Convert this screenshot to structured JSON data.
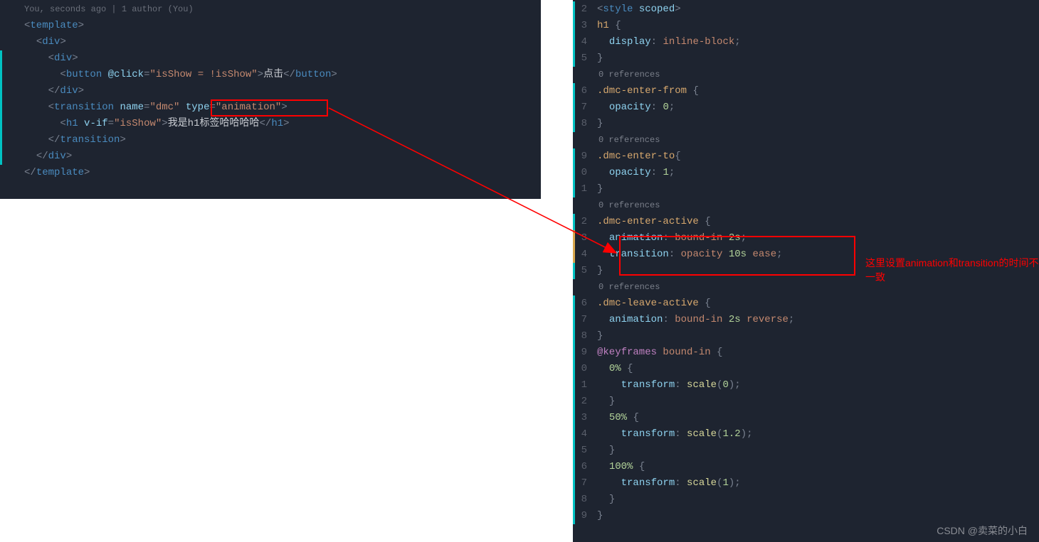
{
  "left": {
    "blame": "You, seconds ago | 1 author (You)",
    "lines": [
      {
        "h": "<span class='punct'>&lt;</span><span class='tag'>template</span><span class='punct'>&gt;</span>"
      },
      {
        "h": "  <span class='punct'>&lt;</span><span class='tag'>div</span><span class='punct'>&gt;</span>"
      },
      {
        "h": "    <span class='punct'>&lt;</span><span class='tag'>div</span><span class='punct'>&gt;</span>",
        "bar": true
      },
      {
        "h": "      <span class='punct'>&lt;</span><span class='tag'>button</span> <span class='attr'>@click</span><span class='punct'>=</span><span class='str'>\"isShow = !isShow\"</span><span class='punct'>&gt;</span><span class='txt'>点击</span><span class='punct'>&lt;/</span><span class='tag'>button</span><span class='punct'>&gt;</span>",
        "bar": true
      },
      {
        "h": "    <span class='punct'>&lt;/</span><span class='tag'>div</span><span class='punct'>&gt;</span>",
        "bar": true
      },
      {
        "h": "    <span class='punct'>&lt;</span><span class='tag'>transition</span> <span class='attr'>name</span><span class='punct'>=</span><span class='str'>\"dmc\"</span> <span class='attr'>type</span><span class='punct'>=</span><span class='str'>\"animation\"</span><span class='punct'>&gt;</span>",
        "bar": true
      },
      {
        "h": "      <span class='punct'>&lt;</span><span class='tag'>h1</span> <span class='attr'>v-if</span><span class='punct'>=</span><span class='str'>\"isShow\"</span><span class='punct'>&gt;</span><span class='txt'>我是h1标签哈哈哈哈</span><span class='punct'>&lt;/</span><span class='tag'>h1</span><span class='punct'>&gt;</span>",
        "bar": true
      },
      {
        "h": "    <span class='punct'>&lt;/</span><span class='tag'>transition</span><span class='punct'>&gt;</span>",
        "bar": true
      },
      {
        "h": "  <span class='punct'>&lt;/</span><span class='tag'>div</span><span class='punct'>&gt;</span>",
        "bar": true
      },
      {
        "h": "<span class='punct'>&lt;/</span><span class='tag'>template</span><span class='punct'>&gt;</span>"
      }
    ]
  },
  "right": {
    "refsLabel": "0 references",
    "lines": [
      {
        "n": "2",
        "h": "<span class='punct'>&lt;</span><span class='tag'>style</span> <span class='attr'>scoped</span><span class='punct'>&gt;</span>"
      },
      {
        "n": "3",
        "h": "<span class='sel'>h1</span> <span class='punct'>{</span>"
      },
      {
        "n": "4",
        "h": "  <span class='prop'>display</span><span class='punct'>:</span> <span class='val'>inline-block</span><span class='punct'>;</span>"
      },
      {
        "n": "5",
        "h": "<span class='punct'>}</span>"
      },
      {
        "refs": true
      },
      {
        "n": "6",
        "h": "<span class='selDmc'>.dmc-enter-from</span> <span class='punct'>{</span>"
      },
      {
        "n": "7",
        "h": "  <span class='prop'>opacity</span><span class='punct'>:</span> <span class='num'>0</span><span class='punct'>;</span>"
      },
      {
        "n": "8",
        "h": "<span class='punct'>}</span>"
      },
      {
        "refs": true
      },
      {
        "n": "9",
        "h": "<span class='selDmc'>.dmc-enter-to</span><span class='punct'>{</span>"
      },
      {
        "n": "0",
        "h": "  <span class='prop'>opacity</span><span class='punct'>:</span> <span class='num'>1</span><span class='punct'>;</span>"
      },
      {
        "n": "1",
        "h": "<span class='punct'>}</span>"
      },
      {
        "refs": true
      },
      {
        "n": "2",
        "h": "<span class='selDmc'>.dmc-enter-active</span> <span class='punct'>{</span>"
      },
      {
        "n": "3",
        "h": "  <span class='prop'>animation</span><span class='punct'>:</span> <span class='val'>bound-in</span> <span class='num'>2s</span><span class='punct'>;</span>",
        "barY": true
      },
      {
        "n": "4",
        "h": "  <span class='prop'>transition</span><span class='punct'>:</span> <span class='val'>opacity</span> <span class='num'>10s</span> <span class='val'>ease</span><span class='punct'>;</span>",
        "barY": true
      },
      {
        "n": "5",
        "h": "<span class='punct'>}</span>"
      },
      {
        "refs": true
      },
      {
        "n": "6",
        "h": "<span class='selDmc'>.dmc-leave-active</span> <span class='punct'>{</span>"
      },
      {
        "n": "7",
        "h": "  <span class='prop'>animation</span><span class='punct'>:</span> <span class='val'>bound-in</span> <span class='num'>2s</span> <span class='val'>reverse</span><span class='punct'>;</span>"
      },
      {
        "n": "8",
        "h": "<span class='punct'>}</span>"
      },
      {
        "n": "9",
        "h": "<span class='kw'>@keyframes</span> <span class='val'>bound-in</span> <span class='punct'>{</span>"
      },
      {
        "n": "0",
        "h": "  <span class='pct'>0%</span> <span class='punct'>{</span>"
      },
      {
        "n": "1",
        "h": "    <span class='prop'>transform</span><span class='punct'>:</span> <span class='fn'>scale</span><span class='punct'>(</span><span class='num'>0</span><span class='punct'>);</span>"
      },
      {
        "n": "2",
        "h": "  <span class='punct'>}</span>"
      },
      {
        "n": "3",
        "h": "  <span class='pct'>50%</span> <span class='punct'>{</span>"
      },
      {
        "n": "4",
        "h": "    <span class='prop'>transform</span><span class='punct'>:</span> <span class='fn'>scale</span><span class='punct'>(</span><span class='num'>1.2</span><span class='punct'>);</span>"
      },
      {
        "n": "5",
        "h": "  <span class='punct'>}</span>"
      },
      {
        "n": "6",
        "h": "  <span class='pct'>100%</span> <span class='punct'>{</span>"
      },
      {
        "n": "7",
        "h": "    <span class='prop'>transform</span><span class='punct'>:</span> <span class='fn'>scale</span><span class='punct'>(</span><span class='num'>1</span><span class='punct'>);</span>"
      },
      {
        "n": "8",
        "h": "  <span class='punct'>}</span>"
      },
      {
        "n": "9",
        "h": "<span class='punct'>}</span>"
      }
    ]
  },
  "note": "这里设置animation和transition的时间不一致",
  "watermark": "CSDN @卖菜的小白"
}
